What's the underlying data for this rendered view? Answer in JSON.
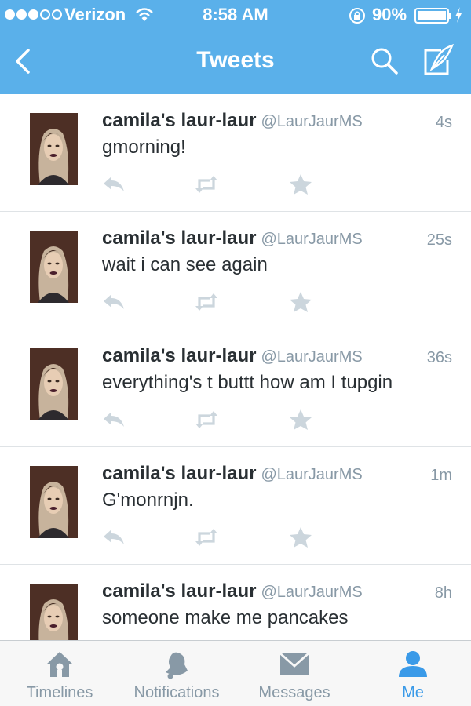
{
  "status_bar": {
    "carrier": "Verizon",
    "time": "8:58 AM",
    "battery": "90%",
    "signal_strength": 3
  },
  "nav": {
    "title": "Tweets",
    "icons": [
      "back-chevron-icon",
      "search-icon",
      "compose-icon"
    ]
  },
  "colors": {
    "brand_blue": "#5ab0ea",
    "active_tab": "#3a9ae8",
    "muted": "#8899a6"
  },
  "tweets": [
    {
      "name": "camila's laur-laur",
      "handle": "@LaurJaurMS",
      "time": "4s",
      "text": "gmorning!"
    },
    {
      "name": "camila's laur-laur",
      "handle": "@LaurJaurMS",
      "time": "25s",
      "text": "wait i can see again"
    },
    {
      "name": "camila's laur-laur",
      "handle": "@LaurJaurMS",
      "time": "36s",
      "text": "everything's t buttt how am I tupgin"
    },
    {
      "name": "camila's laur-laur",
      "handle": "@LaurJaurMS",
      "time": "1m",
      "text": "G'monrnjn."
    },
    {
      "name": "camila's laur-laur",
      "handle": "@LaurJaurMS",
      "time": "8h",
      "text": "someone make me pancakes"
    }
  ],
  "tabs": [
    {
      "label": "Timelines",
      "icon": "home-icon"
    },
    {
      "label": "Notifications",
      "icon": "bell-icon"
    },
    {
      "label": "Messages",
      "icon": "envelope-icon"
    },
    {
      "label": "Me",
      "icon": "person-icon",
      "active": true
    }
  ]
}
